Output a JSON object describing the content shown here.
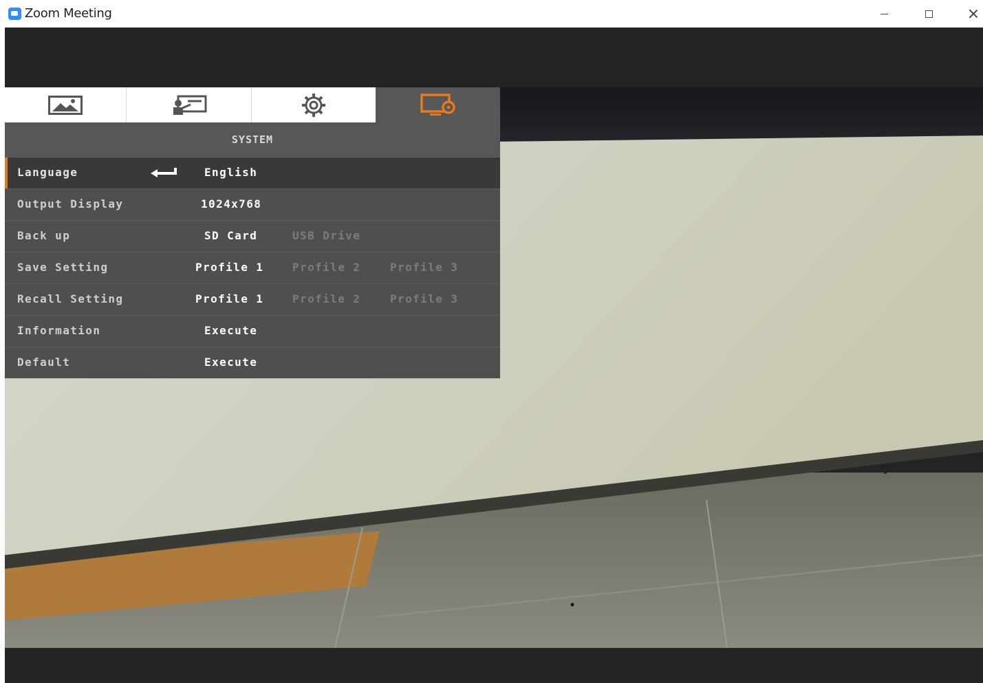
{
  "window": {
    "title": "Zoom Meeting",
    "controls": [
      "minimize",
      "maximize",
      "close"
    ]
  },
  "osd": {
    "tabs": [
      {
        "icon": "picture-icon",
        "active": false
      },
      {
        "icon": "presenter-icon",
        "active": false
      },
      {
        "icon": "gear-icon",
        "active": false
      },
      {
        "icon": "monitor-settings-icon",
        "active": true
      }
    ],
    "header": "SYSTEM",
    "accent_color": "#e87a1d",
    "rows": [
      {
        "label": "Language",
        "options": [
          "English"
        ],
        "selected_index": 0
      },
      {
        "label": "Output Display",
        "options": [
          "1024x768"
        ],
        "selected_index": 0
      },
      {
        "label": "Back up",
        "options": [
          "SD Card",
          "USB Drive"
        ],
        "selected_index": 0
      },
      {
        "label": "Save Setting",
        "options": [
          "Profile 1",
          "Profile 2",
          "Profile 3"
        ],
        "selected_index": 0
      },
      {
        "label": "Recall Setting",
        "options": [
          "Profile 1",
          "Profile 2",
          "Profile 3"
        ],
        "selected_index": 0
      },
      {
        "label": "Information",
        "options": [
          "Execute"
        ],
        "selected_index": 0
      },
      {
        "label": "Default",
        "options": [
          "Execute"
        ],
        "selected_index": 0
      }
    ],
    "focused_row": 0
  }
}
